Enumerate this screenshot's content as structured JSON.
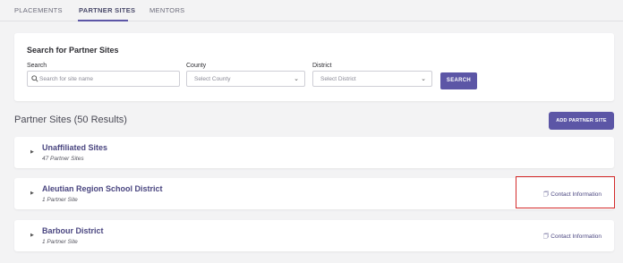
{
  "tabs": [
    {
      "label": "PLACEMENTS"
    },
    {
      "label": "PARTNER SITES",
      "active": true
    },
    {
      "label": "MENTORS"
    }
  ],
  "search": {
    "title": "Search for Partner Sites",
    "search_label": "Search",
    "search_placeholder": "Search for site name",
    "county_label": "County",
    "county_value": "Select County",
    "district_label": "District",
    "district_value": "Select District",
    "button_label": "SEARCH"
  },
  "results": {
    "title": "Partner Sites (50 Results)",
    "add_button": "ADD PARTNER SITE"
  },
  "sites": [
    {
      "name": "Unaffiliated Sites",
      "count": "47 Partner Sites",
      "contact": ""
    },
    {
      "name": "Aleutian Region School District",
      "count": "1 Partner Site",
      "contact": "Contact Information"
    },
    {
      "name": "Barbour District",
      "count": "1 Partner Site",
      "contact": "Contact Information"
    }
  ],
  "colors": {
    "accent": "#5c56a6",
    "highlight": "#d42b2b"
  },
  "icons": {
    "search": "search-icon",
    "expand": "chevron-right-icon",
    "contact": "contact-card-icon",
    "dropdown": "chevron-down-icon"
  }
}
